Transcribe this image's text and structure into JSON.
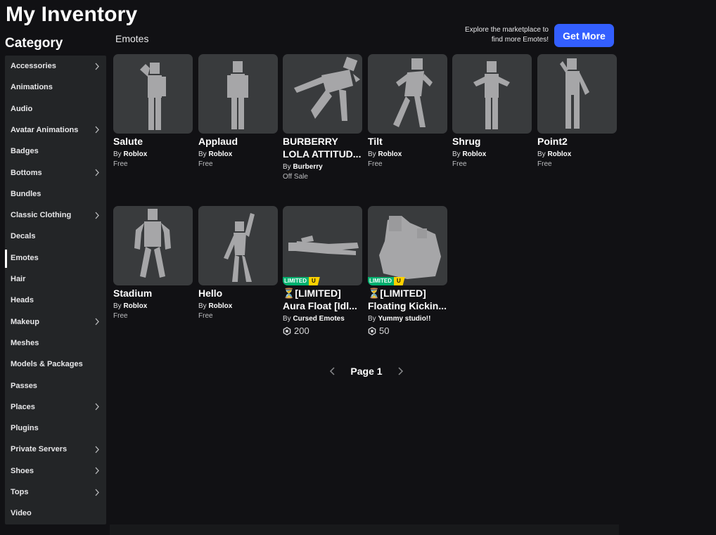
{
  "page_title": "My Inventory",
  "category_title": "Category",
  "sidebar": {
    "items": [
      {
        "label": "Accessories",
        "has_chevron": true
      },
      {
        "label": "Animations",
        "has_chevron": false
      },
      {
        "label": "Audio",
        "has_chevron": false
      },
      {
        "label": "Avatar Animations",
        "has_chevron": true
      },
      {
        "label": "Badges",
        "has_chevron": false
      },
      {
        "label": "Bottoms",
        "has_chevron": true
      },
      {
        "label": "Bundles",
        "has_chevron": false
      },
      {
        "label": "Classic Clothing",
        "has_chevron": true
      },
      {
        "label": "Decals",
        "has_chevron": false
      },
      {
        "label": "Emotes",
        "has_chevron": false,
        "active": true
      },
      {
        "label": "Hair",
        "has_chevron": false
      },
      {
        "label": "Heads",
        "has_chevron": false
      },
      {
        "label": "Makeup",
        "has_chevron": true
      },
      {
        "label": "Meshes",
        "has_chevron": false
      },
      {
        "label": "Models & Packages",
        "has_chevron": false
      },
      {
        "label": "Passes",
        "has_chevron": false
      },
      {
        "label": "Places",
        "has_chevron": true
      },
      {
        "label": "Plugins",
        "has_chevron": false
      },
      {
        "label": "Private Servers",
        "has_chevron": true
      },
      {
        "label": "Shoes",
        "has_chevron": true
      },
      {
        "label": "Tops",
        "has_chevron": true
      },
      {
        "label": "Video",
        "has_chevron": false
      }
    ]
  },
  "section_title": "Emotes",
  "explore": {
    "line1": "Explore the marketplace to",
    "line2": "find more Emotes!",
    "button_label": "Get More"
  },
  "items": [
    {
      "name": "Salute",
      "by": "By",
      "creator": "Roblox",
      "price": "Free",
      "pose": "salute"
    },
    {
      "name": "Applaud",
      "by": "By",
      "creator": "Roblox",
      "price": "Free",
      "pose": "stand"
    },
    {
      "name_line1": "BURBERRY",
      "name_line2": "LOLA ATTITUD...",
      "by": "By",
      "creator": "Burberry",
      "price": "Off Sale",
      "pose": "kick"
    },
    {
      "name": "Tilt",
      "by": "By",
      "creator": "Roblox",
      "price": "Free",
      "pose": "tilt"
    },
    {
      "name": "Shrug",
      "by": "By",
      "creator": "Roblox",
      "price": "Free",
      "pose": "shrug"
    },
    {
      "name": "Point2",
      "by": "By",
      "creator": "Roblox",
      "price": "Free",
      "pose": "point"
    },
    {
      "name": "Stadium",
      "by": "By",
      "creator": "Roblox",
      "price": "Free",
      "pose": "stadium"
    },
    {
      "name": "Hello",
      "by": "By",
      "creator": "Roblox",
      "price": "Free",
      "pose": "hello"
    },
    {
      "name_line1": "⏳[LIMITED]",
      "name_line2": "Aura Float [Idl...",
      "by": "By",
      "creator": "Cursed Emotes",
      "robux": "200",
      "badge_limited": "LIMITED",
      "badge_u": "U",
      "pose": "float"
    },
    {
      "name_line1": "⏳[LIMITED]",
      "name_line2": "Floating Kickin...",
      "by": "By",
      "creator": "Yummy studio!!",
      "robux": "50",
      "badge_limited": "LIMITED",
      "badge_u": "U",
      "pose": "blob"
    }
  ],
  "pager": {
    "label": "Page 1"
  },
  "colors": {
    "accent": "#335fff",
    "limited": "#00b06f",
    "limited_u": "#ffd100",
    "background": "#111114",
    "sidebar": "#232527",
    "card": "#393b3d"
  },
  "icons": {
    "chevron": "chevron-right-icon",
    "prev": "chevron-left-icon",
    "next": "chevron-right-icon",
    "robux": "robux-icon",
    "hourglass": "hourglass-icon"
  }
}
